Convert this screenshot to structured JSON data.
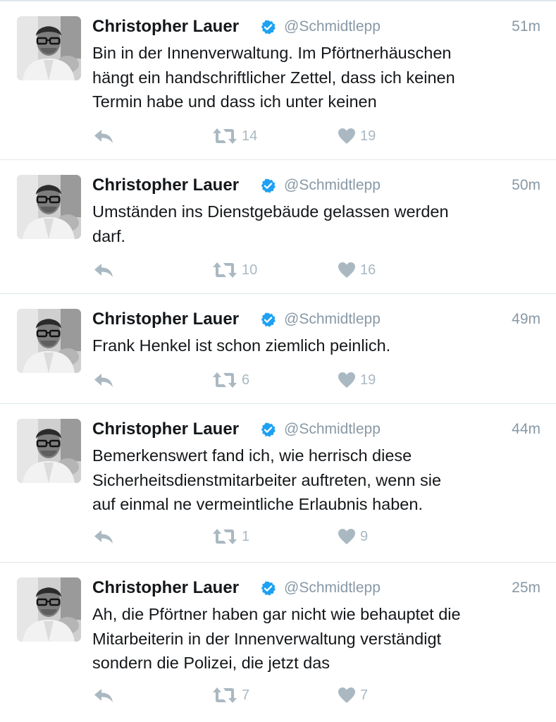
{
  "colors": {
    "verified": "#1da1f2",
    "muted": "#8899a6",
    "action_icon": "#aab8c2",
    "divider": "#e1e8ed",
    "text": "#14171a"
  },
  "icons": {
    "verified": "verified-badge-icon",
    "reply": "reply-arrow-icon",
    "retweet": "retweet-icon",
    "like": "heart-icon"
  },
  "tweets": [
    {
      "name": "Christopher Lauer",
      "handle": "@Schmidtlepp",
      "time": "51m",
      "text": "Bin in der Innenverwaltung. Im Pförtnerhäuschen\nhängt ein handschriftlicher Zettel, dass ich keinen\nTermin habe und dass ich unter keinen",
      "retweets": "14",
      "likes": "19"
    },
    {
      "name": "Christopher Lauer",
      "handle": "@Schmidtlepp",
      "time": "50m",
      "text": "Umständen ins Dienstgebäude gelassen werden\ndarf.",
      "retweets": "10",
      "likes": "16"
    },
    {
      "name": "Christopher Lauer",
      "handle": "@Schmidtlepp",
      "time": "49m",
      "text": "Frank Henkel ist schon ziemlich peinlich.",
      "retweets": "6",
      "likes": "19"
    },
    {
      "name": "Christopher Lauer",
      "handle": "@Schmidtlepp",
      "time": "44m",
      "text": "Bemerkenswert fand ich, wie herrisch diese\nSicherheitsdienstmitarbeiter auftreten, wenn sie\nauf einmal ne vermeintliche Erlaubnis haben.",
      "retweets": "1",
      "likes": "9"
    },
    {
      "name": "Christopher Lauer",
      "handle": "@Schmidtlepp",
      "time": "25m",
      "text": "Ah, die Pförtner haben gar nicht wie behauptet die\nMitarbeiterin in der Innenverwaltung verständigt\nsondern die Polizei, die jetzt das",
      "retweets": "7",
      "likes": "7"
    }
  ]
}
